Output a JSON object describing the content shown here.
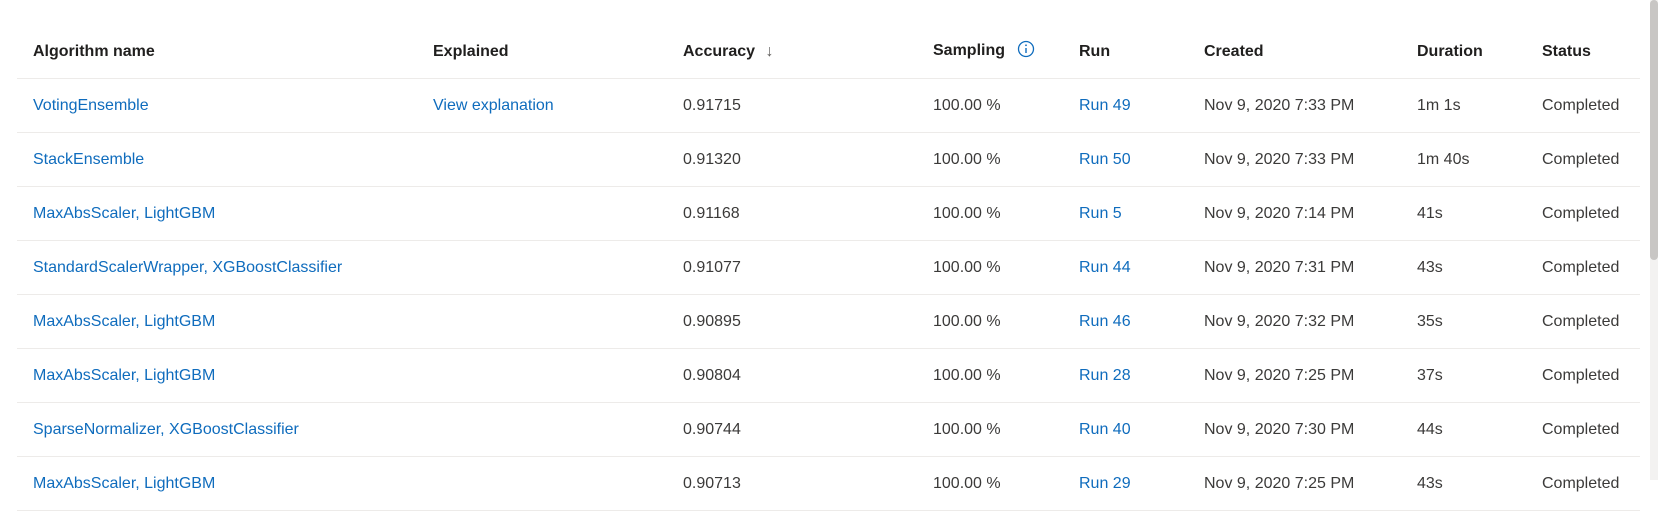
{
  "table": {
    "headers": {
      "algorithm": "Algorithm name",
      "explained": "Explained",
      "accuracy": "Accuracy",
      "sampling": "Sampling",
      "run": "Run",
      "created": "Created",
      "duration": "Duration",
      "status": "Status"
    },
    "sort_indicator": "↓",
    "rows": [
      {
        "algorithm": "VotingEnsemble",
        "explained": "View explanation",
        "accuracy": "0.91715",
        "sampling": "100.00 %",
        "run": "Run 49",
        "created": "Nov 9, 2020 7:33 PM",
        "duration": "1m 1s",
        "status": "Completed"
      },
      {
        "algorithm": "StackEnsemble",
        "explained": "",
        "accuracy": "0.91320",
        "sampling": "100.00 %",
        "run": "Run 50",
        "created": "Nov 9, 2020 7:33 PM",
        "duration": "1m 40s",
        "status": "Completed"
      },
      {
        "algorithm": "MaxAbsScaler, LightGBM",
        "explained": "",
        "accuracy": "0.91168",
        "sampling": "100.00 %",
        "run": "Run 5",
        "created": "Nov 9, 2020 7:14 PM",
        "duration": "41s",
        "status": "Completed"
      },
      {
        "algorithm": "StandardScalerWrapper, XGBoostClassifier",
        "explained": "",
        "accuracy": "0.91077",
        "sampling": "100.00 %",
        "run": "Run 44",
        "created": "Nov 9, 2020 7:31 PM",
        "duration": "43s",
        "status": "Completed"
      },
      {
        "algorithm": "MaxAbsScaler, LightGBM",
        "explained": "",
        "accuracy": "0.90895",
        "sampling": "100.00 %",
        "run": "Run 46",
        "created": "Nov 9, 2020 7:32 PM",
        "duration": "35s",
        "status": "Completed"
      },
      {
        "algorithm": "MaxAbsScaler, LightGBM",
        "explained": "",
        "accuracy": "0.90804",
        "sampling": "100.00 %",
        "run": "Run 28",
        "created": "Nov 9, 2020 7:25 PM",
        "duration": "37s",
        "status": "Completed"
      },
      {
        "algorithm": "SparseNormalizer, XGBoostClassifier",
        "explained": "",
        "accuracy": "0.90744",
        "sampling": "100.00 %",
        "run": "Run 40",
        "created": "Nov 9, 2020 7:30 PM",
        "duration": "44s",
        "status": "Completed"
      },
      {
        "algorithm": "MaxAbsScaler, LightGBM",
        "explained": "",
        "accuracy": "0.90713",
        "sampling": "100.00 %",
        "run": "Run 29",
        "created": "Nov 9, 2020 7:25 PM",
        "duration": "43s",
        "status": "Completed"
      }
    ]
  },
  "icons": {
    "sort": "arrow-down-icon",
    "info": "info-icon"
  },
  "colors": {
    "link": "#0f6cbd",
    "text": "#323130",
    "divider": "#edebe9"
  }
}
